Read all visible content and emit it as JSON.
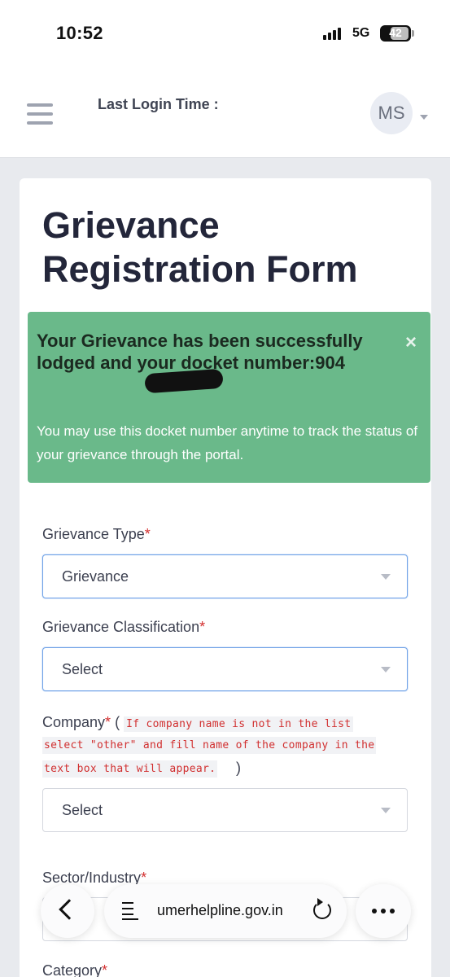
{
  "status_bar": {
    "time": "10:52",
    "network": "5G",
    "battery": "42"
  },
  "header": {
    "last_login_label": "Last Login Time :",
    "avatar_initials": "MS"
  },
  "form": {
    "title": "Grievance Registration Form",
    "alert": {
      "title": "Your Grievance has been successfully lodged and your docket number:904",
      "message": "You may use this docket number anytime to track the status of your grievance through the portal.",
      "close_symbol": "×",
      "color": "#6ab98a"
    },
    "fields": {
      "grievance_type": {
        "label": "Grievance Type",
        "required_mark": "*",
        "value": "Grievance"
      },
      "classification": {
        "label": "Grievance Classification",
        "required_mark": "*",
        "value": "Select"
      },
      "company": {
        "label": "Company",
        "required_mark": "*",
        "paren_open": "(",
        "paren_close": ")",
        "hint_lines": [
          "If company name is not in the list",
          "select \"other\" and fill name of the company in the",
          "text box that will appear."
        ],
        "value": "Select"
      },
      "sector": {
        "label": "Sector/Industry",
        "required_mark": "*"
      },
      "category": {
        "label": "Category",
        "required_mark": "*"
      }
    }
  },
  "browser": {
    "url": "umerhelpline.gov.in",
    "back_icon": "chevron-left-icon",
    "reload_icon": "reload-icon",
    "more_icon": "more-icon"
  }
}
